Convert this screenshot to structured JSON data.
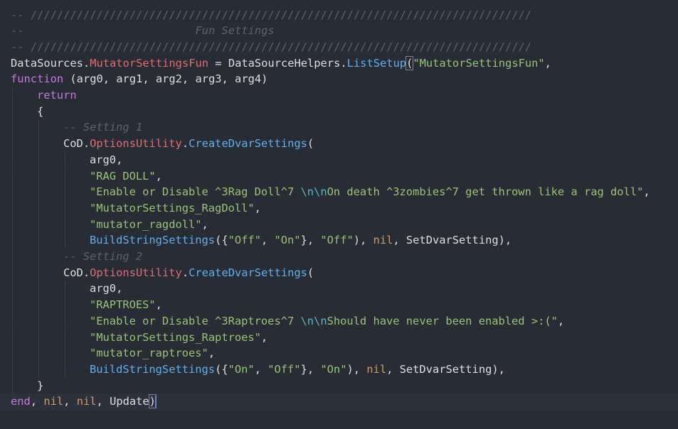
{
  "editor": {
    "lines": [
      {
        "indent": 0,
        "tokens": [
          {
            "t": "-- ////////////////////////////////////////////////////////////////////////////",
            "c": "cm-line"
          }
        ]
      },
      {
        "indent": 0,
        "tokens": [
          {
            "t": "--                          ",
            "c": "cm-line"
          },
          {
            "t": "Fun Settings",
            "c": "cm"
          }
        ]
      },
      {
        "indent": 0,
        "tokens": [
          {
            "t": "-- ////////////////////////////////////////////////////////////////////////////",
            "c": "cm-line"
          }
        ]
      },
      {
        "indent": 0,
        "tokens": [
          {
            "t": "DataSources",
            "c": "pun"
          },
          {
            "t": ".",
            "c": "pun"
          },
          {
            "t": "MutatorSettingsFun",
            "c": "prop"
          },
          {
            "t": " = ",
            "c": "pun"
          },
          {
            "t": "DataSourceHelpers",
            "c": "pun"
          },
          {
            "t": ".",
            "c": "pun"
          },
          {
            "t": "ListSetup",
            "c": "fn"
          },
          {
            "t": "(",
            "c": "pun",
            "match": true
          },
          {
            "t": "\"MutatorSettingsFun\"",
            "c": "str"
          },
          {
            "t": ",",
            "c": "pun"
          }
        ]
      },
      {
        "indent": 0,
        "tokens": [
          {
            "t": "function",
            "c": "kw"
          },
          {
            "t": " (arg0, arg1, arg2, arg3, arg4)",
            "c": "pun"
          }
        ]
      },
      {
        "indent": 1,
        "tokens": [
          {
            "t": "return",
            "c": "kw"
          }
        ]
      },
      {
        "indent": 1,
        "tokens": [
          {
            "t": "{",
            "c": "pun"
          }
        ]
      },
      {
        "indent": 2,
        "tokens": [
          {
            "t": "-- Setting 1",
            "c": "cm"
          }
        ]
      },
      {
        "indent": 2,
        "tokens": [
          {
            "t": "CoD",
            "c": "pun"
          },
          {
            "t": ".",
            "c": "pun"
          },
          {
            "t": "OptionsUtility",
            "c": "prop"
          },
          {
            "t": ".",
            "c": "pun"
          },
          {
            "t": "CreateDvarSettings",
            "c": "fn"
          },
          {
            "t": "(",
            "c": "pun"
          }
        ]
      },
      {
        "indent": 3,
        "tokens": [
          {
            "t": "arg0,",
            "c": "pun"
          }
        ]
      },
      {
        "indent": 3,
        "tokens": [
          {
            "t": "\"RAG DOLL\"",
            "c": "str"
          },
          {
            "t": ",",
            "c": "pun"
          }
        ]
      },
      {
        "indent": 3,
        "tokens": [
          {
            "t": "\"Enable or Disable ^3Rag Doll^7 ",
            "c": "str"
          },
          {
            "t": "\\n\\n",
            "c": "esc"
          },
          {
            "t": "On death ^3zombies^7 get thrown like a rag doll\"",
            "c": "str"
          },
          {
            "t": ",",
            "c": "pun"
          }
        ]
      },
      {
        "indent": 3,
        "tokens": [
          {
            "t": "\"MutatorSettings_RagDoll\"",
            "c": "str"
          },
          {
            "t": ",",
            "c": "pun"
          }
        ]
      },
      {
        "indent": 3,
        "tokens": [
          {
            "t": "\"mutator_ragdoll\"",
            "c": "str"
          },
          {
            "t": ",",
            "c": "pun"
          }
        ]
      },
      {
        "indent": 3,
        "tokens": [
          {
            "t": "BuildStringSettings",
            "c": "fn"
          },
          {
            "t": "({",
            "c": "pun"
          },
          {
            "t": "\"Off\"",
            "c": "str"
          },
          {
            "t": ", ",
            "c": "pun"
          },
          {
            "t": "\"On\"",
            "c": "str"
          },
          {
            "t": "}, ",
            "c": "pun"
          },
          {
            "t": "\"Off\"",
            "c": "str"
          },
          {
            "t": "), ",
            "c": "pun"
          },
          {
            "t": "nil",
            "c": "lit"
          },
          {
            "t": ", SetDvarSetting),",
            "c": "pun"
          }
        ]
      },
      {
        "indent": 2,
        "tokens": [
          {
            "t": "-- Setting 2",
            "c": "cm"
          }
        ]
      },
      {
        "indent": 2,
        "tokens": [
          {
            "t": "CoD",
            "c": "pun"
          },
          {
            "t": ".",
            "c": "pun"
          },
          {
            "t": "OptionsUtility",
            "c": "prop"
          },
          {
            "t": ".",
            "c": "pun"
          },
          {
            "t": "CreateDvarSettings",
            "c": "fn"
          },
          {
            "t": "(",
            "c": "pun"
          }
        ]
      },
      {
        "indent": 3,
        "tokens": [
          {
            "t": "arg0,",
            "c": "pun"
          }
        ]
      },
      {
        "indent": 3,
        "tokens": [
          {
            "t": "\"RAPTROES\"",
            "c": "str"
          },
          {
            "t": ",",
            "c": "pun"
          }
        ]
      },
      {
        "indent": 3,
        "tokens": [
          {
            "t": "\"Enable or Disable ^3Raptroes^7 ",
            "c": "str"
          },
          {
            "t": "\\n\\n",
            "c": "esc"
          },
          {
            "t": "Should have never been enabled >:(\"",
            "c": "str"
          },
          {
            "t": ",",
            "c": "pun"
          }
        ]
      },
      {
        "indent": 3,
        "tokens": [
          {
            "t": "\"MutatorSettings_Raptroes\"",
            "c": "str"
          },
          {
            "t": ",",
            "c": "pun"
          }
        ]
      },
      {
        "indent": 3,
        "tokens": [
          {
            "t": "\"mutator_raptroes\"",
            "c": "str"
          },
          {
            "t": ",",
            "c": "pun"
          }
        ]
      },
      {
        "indent": 3,
        "tokens": [
          {
            "t": "BuildStringSettings",
            "c": "fn"
          },
          {
            "t": "({",
            "c": "pun"
          },
          {
            "t": "\"On\"",
            "c": "str"
          },
          {
            "t": ", ",
            "c": "pun"
          },
          {
            "t": "\"Off\"",
            "c": "str"
          },
          {
            "t": "}, ",
            "c": "pun"
          },
          {
            "t": "\"On\"",
            "c": "str"
          },
          {
            "t": "), ",
            "c": "pun"
          },
          {
            "t": "nil",
            "c": "lit"
          },
          {
            "t": ", SetDvarSetting),",
            "c": "pun"
          }
        ]
      },
      {
        "indent": 1,
        "tokens": [
          {
            "t": "}",
            "c": "pun"
          }
        ]
      },
      {
        "indent": 0,
        "current": true,
        "cursor": true,
        "tokens": [
          {
            "t": "end",
            "c": "kw"
          },
          {
            "t": ", ",
            "c": "pun"
          },
          {
            "t": "nil",
            "c": "lit"
          },
          {
            "t": ", ",
            "c": "pun"
          },
          {
            "t": "nil",
            "c": "lit"
          },
          {
            "t": ", Update",
            "c": "pun"
          },
          {
            "t": ")",
            "c": "pun",
            "match": true
          }
        ]
      }
    ]
  },
  "colors": {
    "background": "#282c34",
    "keyword": "#c678dd",
    "string": "#98c379",
    "function": "#61afef",
    "property": "#e06c75",
    "comment": "#5c6370",
    "literal": "#d19a66",
    "escape": "#56b6c2"
  }
}
